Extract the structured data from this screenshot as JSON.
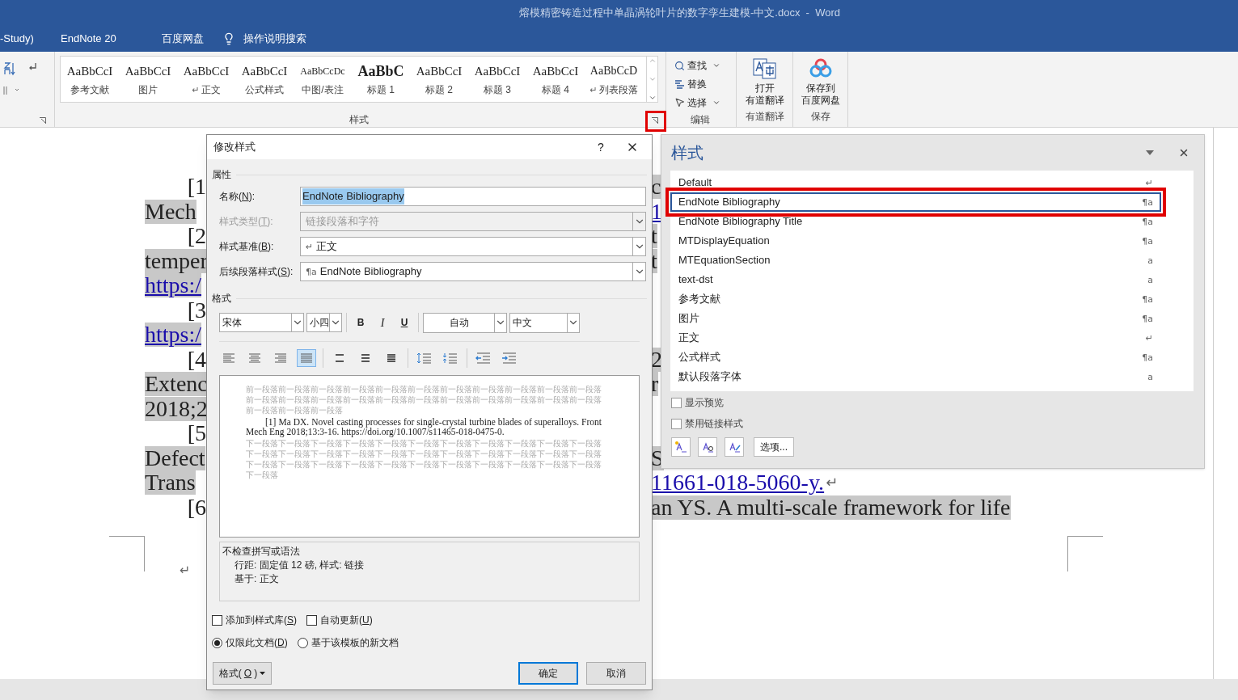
{
  "window": {
    "title": "熔模精密铸造过程中单晶涡轮叶片的数字孪生建模-中文.docx  -  Word"
  },
  "tabs": [
    "-Study)",
    "EndNote 20",
    "百度网盘"
  ],
  "tell_me": {
    "placeholder": "操作说明搜索"
  },
  "ribbon": {
    "gallery": [
      {
        "sample": "AaBbCcI",
        "label": "参考文献",
        "kind": "normal"
      },
      {
        "sample": "AaBbCcI",
        "label": "图片",
        "kind": "normal"
      },
      {
        "sample": "AaBbCcI",
        "symbol": "↵",
        "label": "正文",
        "kind": "normal"
      },
      {
        "sample": "AaBbCcI",
        "label": "公式样式",
        "kind": "normal"
      },
      {
        "sample": "AaBbCcDc",
        "label": "中图/表注",
        "kind": "small"
      },
      {
        "sample": "AaBbC",
        "label": "标题 1",
        "kind": "heading"
      },
      {
        "sample": "AaBbCcI",
        "label": "标题 2",
        "kind": "normal"
      },
      {
        "sample": "AaBbCcI",
        "label": "标题 3",
        "kind": "normal"
      },
      {
        "sample": "AaBbCcI",
        "label": "标题 4",
        "kind": "normal"
      },
      {
        "sample": "AaBbCcD",
        "symbol": "↵",
        "label": "列表段落",
        "kind": "sans"
      }
    ],
    "styles_group": "样式",
    "edit": {
      "commands": [
        {
          "label": "查找",
          "dropdown": true
        },
        {
          "label": "替换",
          "dropdown": false
        },
        {
          "label": "选择",
          "dropdown": true
        }
      ],
      "group": "编辑"
    },
    "youdao": {
      "lines": [
        "打开",
        "有道翻译"
      ],
      "group": "有道翻译"
    },
    "baidu": {
      "lines": [
        "保存到",
        "百度网盘"
      ],
      "group": "保存"
    }
  },
  "document": {
    "rows": [
      {
        "left": {
          "text": "[1",
          "kind": "indent"
        },
        "right": {
          "text": "c",
          "kind": "plain"
        }
      },
      {
        "left": {
          "text": "Mech",
          "kind": "start"
        },
        "right": {
          "text": "1",
          "kind": "link"
        }
      },
      {
        "left": {
          "text": "[2",
          "kind": "indent"
        },
        "right": {
          "text": "t",
          "kind": "plain"
        }
      },
      {
        "left": {
          "text": "temper",
          "kind": "start"
        },
        "right": {
          "text": "t",
          "kind": "plain"
        }
      },
      {
        "left": {
          "text": "https:/",
          "kind": "link"
        }
      },
      {
        "left": {
          "text": "[3",
          "kind": "indent"
        }
      },
      {
        "left": {
          "text": "https:/",
          "kind": "link"
        }
      },
      {
        "left": {
          "text": "[4",
          "kind": "indent"
        },
        "right": {
          "text": "2",
          "kind": "plain"
        }
      },
      {
        "left": {
          "text": "Extenc",
          "kind": "start"
        },
        "right": {
          "text": "r",
          "kind": "plain"
        }
      },
      {
        "left": {
          "text": "2018;2",
          "kind": "start"
        }
      },
      {
        "left": {
          "text": "[5",
          "kind": "indent"
        }
      },
      {
        "left": {
          "text": "Defect",
          "kind": "start"
        },
        "right": {
          "text": "S",
          "kind": "plain"
        }
      },
      {
        "left": {
          "text": "Trans",
          "kind": "start"
        },
        "right": {
          "text": "11661-018-5060-y.",
          "kind": "link",
          "end_symbol": "↵"
        }
      },
      {
        "left": {
          "text": "[6",
          "kind": "indent"
        },
        "right": {
          "text": "an YS. A multi-scale framework for life",
          "kind": "plain"
        }
      }
    ],
    "end_symbol": "↵"
  },
  "dialog": {
    "title": "修改样式",
    "help": "?",
    "properties_heading": "属性",
    "fields": [
      {
        "prefix": "名称(",
        "key": "N",
        "suffix": "):",
        "value": "EndNote Bibliography",
        "kind": "text",
        "disabled": false
      },
      {
        "prefix": "样式类型(",
        "key": "T",
        "suffix": "):",
        "value": "链接段落和字符",
        "kind": "select",
        "disabled": true
      },
      {
        "prefix": "样式基准(",
        "key": "B",
        "suffix": "):",
        "symbol": "↵",
        "value": "正文",
        "kind": "select",
        "disabled": false
      },
      {
        "prefix": "后续段落样式(",
        "key": "S",
        "suffix": "):",
        "symbol": "¶a",
        "value": "EndNote Bibliography",
        "kind": "select",
        "disabled": false
      }
    ],
    "format_heading": "格式",
    "font": "宋体",
    "size": "小四",
    "bold": "B",
    "italic": "I",
    "underline": "U",
    "font_colour_option": "自动",
    "script": "中文",
    "alignment": [
      {
        "selected": false
      },
      {
        "selected": false
      },
      {
        "selected": false
      },
      {
        "selected": true
      }
    ],
    "preview": {
      "before": "前一段落前一段落前一段落前一段落前一段落前一段落前一段落前一段落前一段落前一段落前一段落前一段落前一段落前一段落前一段落前一段落前一段落前一段落前一段落前一段落前一段落前一段落前一段落前一段落前一段落",
      "sample": "[1] Ma DX. Novel casting processes for single-crystal turbine blades of superalloys. Front Mech Eng 2018;13:3-16. https://doi.org/10.1007/s11465-018-0475-0.",
      "after": "下一段落下一段落下一段落下一段落下一段落下一段落下一段落下一段落下一段落下一段落下一段落下一段落下一段落下一段落下一段落下一段落下一段落下一段落下一段落下一段落下一段落下一段落下一段落下一段落下一段落下一段落下一段落下一段落下一段落下一段落下一段落下一段落下一段落下一段落"
    },
    "description": [
      "不检查拼写或语法",
      "行距: 固定值 12 磅, 样式: 链接",
      "基于: 正文"
    ],
    "checkboxes": [
      {
        "prefix": "添加到样式库(",
        "key": "S",
        "suffix": ")",
        "checked": false
      },
      {
        "prefix": "自动更新(",
        "key": "U",
        "suffix": ")",
        "checked": false
      }
    ],
    "radios": [
      {
        "prefix": "仅限此文档(",
        "key": "D",
        "suffix": ")",
        "selected": true
      },
      {
        "prefix": "基于该模板的新文档",
        "selected": false
      }
    ],
    "format_button": {
      "prefix": "格式(",
      "key": "O",
      "suffix": ")"
    },
    "ok": "确定",
    "cancel": "取消"
  },
  "styles_pane": {
    "title": "样式",
    "items": [
      {
        "name": "Default",
        "symbol": "↵",
        "selected": false
      },
      {
        "name": "EndNote Bibliography",
        "symbol": "¶a",
        "selected": true
      },
      {
        "name": "EndNote Bibliography Title",
        "symbol": "¶a",
        "selected": false
      },
      {
        "name": "MTDisplayEquation",
        "symbol": "¶a",
        "selected": false
      },
      {
        "name": "MTEquationSection",
        "symbol": "a",
        "selected": false
      },
      {
        "name": "text-dst",
        "symbol": "a",
        "selected": false
      },
      {
        "name": "参考文献",
        "symbol": "¶a",
        "selected": false
      },
      {
        "name": "图片",
        "symbol": "¶a",
        "selected": false
      },
      {
        "name": "正文",
        "symbol": "↵",
        "selected": false
      },
      {
        "name": "公式样式",
        "symbol": "¶a",
        "selected": false
      },
      {
        "name": "默认段落字体",
        "symbol": "a",
        "selected": false
      }
    ],
    "checkboxes": [
      {
        "label": "显示预览",
        "checked": false
      },
      {
        "label": "禁用链接样式",
        "checked": false
      }
    ],
    "options": "选项..."
  }
}
